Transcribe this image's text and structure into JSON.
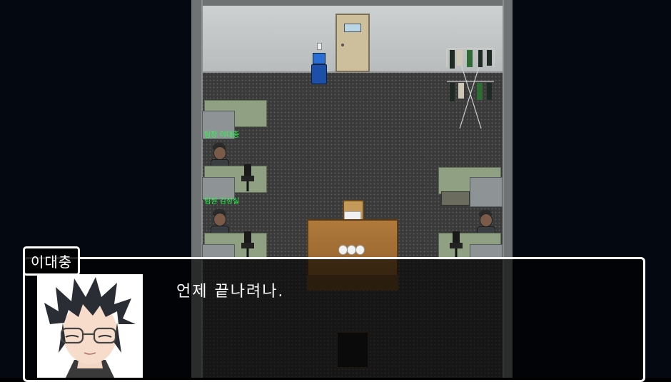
{
  "scene": {
    "nameplates": [
      "팀장 이대충",
      "팀원 김성실",
      "팀원 박무명"
    ],
    "colors": {
      "void": "#040810",
      "floor": "#3a3a3a",
      "wall": "#cfd2d2",
      "desk": "#8fa083",
      "table": "#a06c32",
      "nameplate_text": "#22ff44"
    }
  },
  "dialog": {
    "speaker": "이대충",
    "text": "언제 끝나려나.",
    "portrait_icon": "character-portrait-glasses"
  }
}
